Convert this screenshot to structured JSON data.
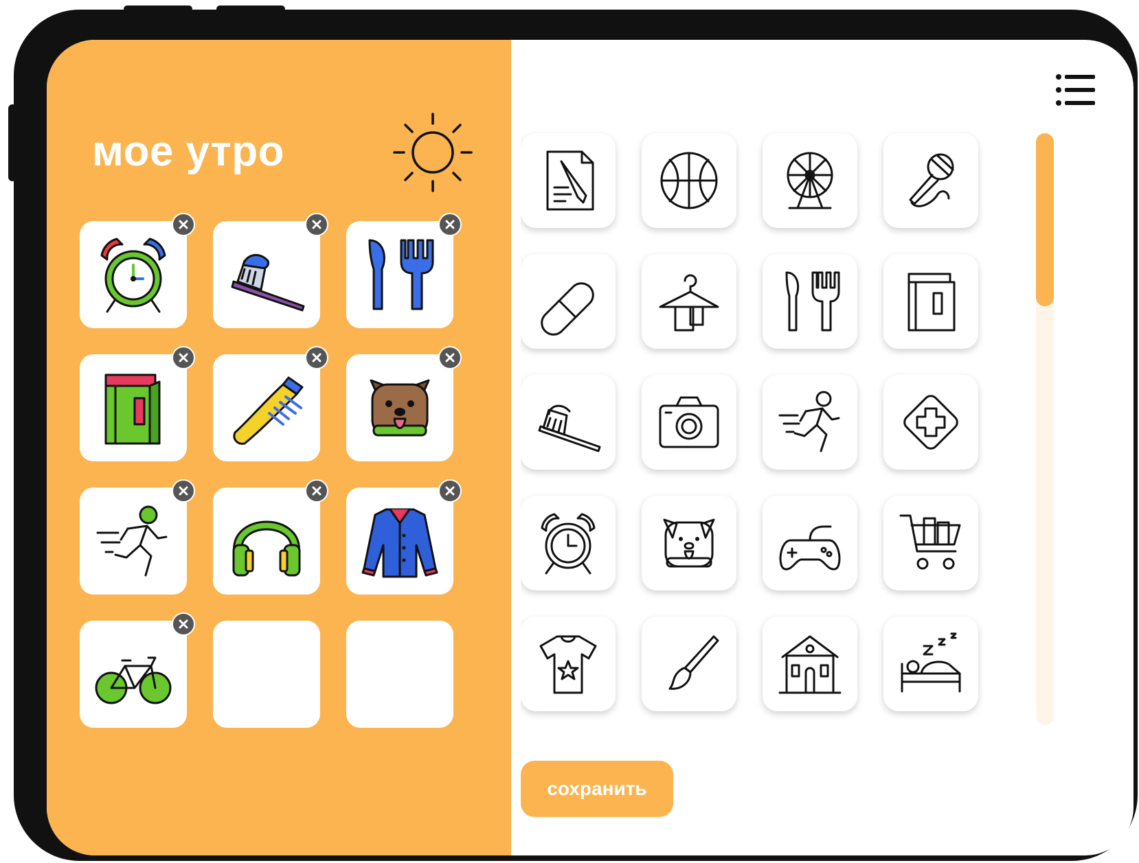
{
  "routine": {
    "title": "мое утро",
    "theme_color": "#fbb450",
    "header_icon": "sun-icon",
    "selected_tiles": [
      {
        "icon": "alarm-clock-icon",
        "removable": true
      },
      {
        "icon": "toothbrush-icon",
        "removable": true
      },
      {
        "icon": "fork-knife-icon",
        "removable": true
      },
      {
        "icon": "book-icon",
        "removable": true
      },
      {
        "icon": "comb-icon",
        "removable": true
      },
      {
        "icon": "dog-icon",
        "removable": true
      },
      {
        "icon": "running-icon",
        "removable": true
      },
      {
        "icon": "headphones-icon",
        "removable": true
      },
      {
        "icon": "jacket-icon",
        "removable": true
      },
      {
        "icon": "bicycle-icon",
        "removable": true
      },
      {
        "icon": "empty-slot",
        "removable": false
      },
      {
        "icon": "empty-slot",
        "removable": false
      }
    ]
  },
  "library": {
    "menu_icon": "list-menu-icon",
    "icons": [
      "document-pen-icon",
      "basketball-icon",
      "ferris-wheel-icon",
      "microphone-icon",
      "pill-icon",
      "clothes-hanger-icon",
      "fork-knife-icon",
      "book-icon",
      "toothbrush-icon",
      "camera-icon",
      "running-icon",
      "first-aid-icon",
      "alarm-clock-icon",
      "dog-icon",
      "gamepad-icon",
      "shopping-cart-icon",
      "tshirt-icon",
      "paintbrush-icon",
      "school-building-icon",
      "sleep-bed-icon"
    ],
    "scroll_position": 0.0
  },
  "actions": {
    "save_label": "сохранить"
  }
}
